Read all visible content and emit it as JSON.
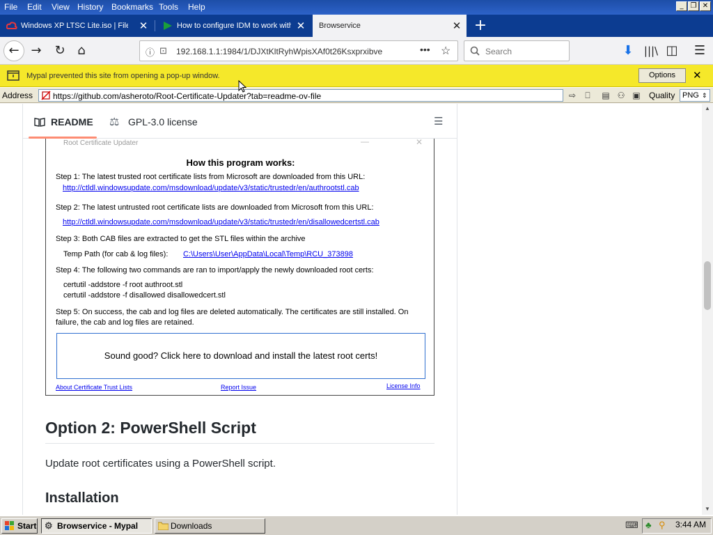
{
  "menubar": {
    "items": [
      "File",
      "Edit",
      "View",
      "History",
      "Bookmarks",
      "Tools",
      "Help"
    ],
    "window_buttons": [
      "minimize",
      "restore",
      "close"
    ]
  },
  "tabs": [
    {
      "label": "Windows XP LTSC Lite.iso | Files.fm",
      "icon": "cloud-icon",
      "active": false
    },
    {
      "label": "How to configure IDM to work with",
      "icon": "play-icon",
      "active": false
    },
    {
      "label": "Browservice",
      "icon": "",
      "active": true
    }
  ],
  "nav": {
    "url": "192.168.1.1:1984/1/DJXtKltRyhWpisXAf0t26Ksxprxibve",
    "search_placeholder": "Search"
  },
  "popup_bar": {
    "message": "Mypal prevented this site from opening a pop-up window.",
    "options_label": "Options"
  },
  "address_bar": {
    "label": "Address",
    "url": "https://github.com/asheroto/Root-Certificate-Updater?tab=readme-ov-file",
    "quality_label": "Quality",
    "quality_value": "PNG"
  },
  "readme": {
    "tab_readme": "README",
    "tab_license": "GPL-3.0 license"
  },
  "screenshot": {
    "window_title": "Root Certificate Updater",
    "heading": "How this program works:",
    "step1": "Step 1: The latest trusted root certificate lists from Microsoft are downloaded from this URL:",
    "step1_link": "http://ctldl.windowsupdate.com/msdownload/update/v3/static/trustedr/en/authrootstl.cab",
    "step2": "Step 2: The latest untrusted root certificate lists are downloaded from Microsoft from this URL:",
    "step2_link": "http://ctldl.windowsupdate.com/msdownload/update/v3/static/trustedr/en/disallowedcertstl.cab",
    "step3": "Step 3: Both CAB files are extracted to get the STL files within the archive",
    "temp_label": "Temp Path (for cab & log files):",
    "temp_link": "C:\\Users\\User\\AppData\\Local\\Temp\\RCU_373898",
    "step4": "Step 4: The following two commands are ran to import/apply the newly downloaded root certs:",
    "cmd1": "certutil -addstore -f root authroot.stl",
    "cmd2": "certutil -addstore -f disallowed disallowedcert.stl",
    "step5": "Step 5: On success, the cab and log files are deleted automatically. The certificates are still installed. On failure, the cab and log files are retained.",
    "button": "Sound good? Click here to download and install the latest root certs!",
    "footer_link1": "About Certificate Trust Lists",
    "footer_link2": "Report Issue",
    "footer_link3": "License Info"
  },
  "content": {
    "option2_heading": "Option 2: PowerShell Script",
    "option2_text": "Update root certificates using a PowerShell script.",
    "installation_heading": "Installation"
  },
  "taskbar": {
    "start": "Start",
    "tasks": [
      {
        "label": "Browservice - Mypal",
        "active": true
      },
      {
        "label": "Downloads",
        "active": false
      }
    ],
    "clock": "3:44 AM"
  }
}
